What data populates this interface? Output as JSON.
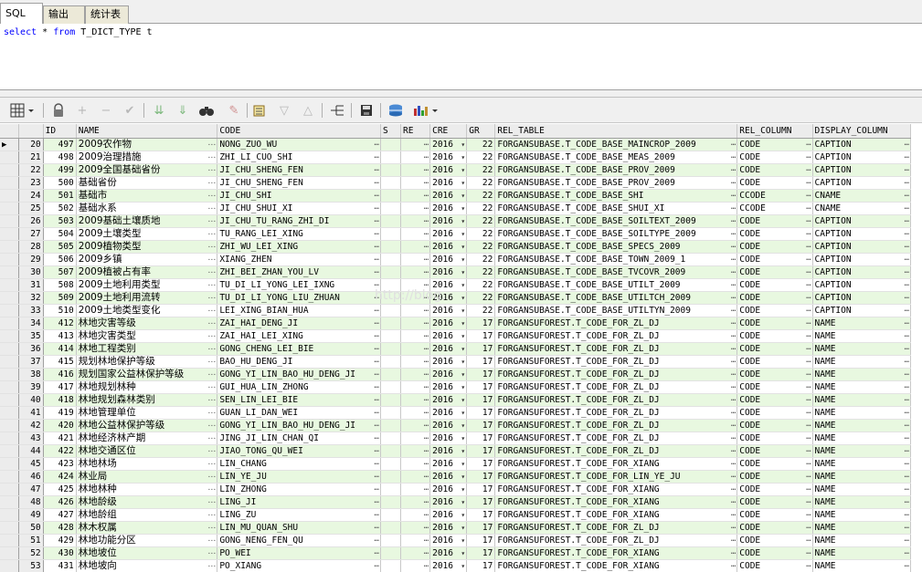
{
  "tabs": [
    "SQL",
    "输出",
    "统计表"
  ],
  "editor": {
    "kw1": "select",
    "star": " * ",
    "kw2": "from",
    "rest": " T_DICT_TYPE t"
  },
  "columns": [
    "",
    "ID",
    "NAME",
    "CODE",
    "S",
    "RE",
    "CRE",
    "GR",
    "REL_TABLE",
    "REL_COLUMN",
    "DISPLAY_COLUMN"
  ],
  "watermark": "http://blog.",
  "rows": [
    [
      "20",
      "497",
      "2009农作物",
      "NONG_ZUO_WU",
      "2016",
      "22",
      "FORGANSUBASE.T_CODE_BASE_MAINCROP_2009",
      "CODE",
      "CAPTION"
    ],
    [
      "21",
      "498",
      "2009治理措施",
      "ZHI_LI_CUO_SHI",
      "2016",
      "22",
      "FORGANSUBASE.T_CODE_BASE_MEAS_2009",
      "CODE",
      "CAPTION"
    ],
    [
      "22",
      "499",
      "2009全国基础省份",
      "JI_CHU_SHENG_FEN",
      "2016",
      "22",
      "FORGANSUBASE.T_CODE_BASE_PROV_2009",
      "CODE",
      "CAPTION"
    ],
    [
      "23",
      "500",
      "基础省份",
      "JI_CHU_SHENG_FEN",
      "2016",
      "22",
      "FORGANSUBASE.T_CODE_BASE_PROV_2009",
      "CODE",
      "CAPTION"
    ],
    [
      "24",
      "501",
      "基础市",
      "JI_CHU_SHI",
      "2016",
      "22",
      "FORGANSUBASE.T_CODE_BASE_SHI",
      "CCODE",
      "CNAME"
    ],
    [
      "25",
      "502",
      "基础水系",
      "JI_CHU_SHUI_XI",
      "2016",
      "22",
      "FORGANSUBASE.T_CODE_BASE_SHUI_XI",
      "CCODE",
      "CNAME"
    ],
    [
      "26",
      "503",
      "2009基础土壤质地",
      "JI_CHU_TU_RANG_ZHI_DI",
      "2016",
      "22",
      "FORGANSUBASE.T_CODE_BASE_SOILTEXT_2009",
      "CODE",
      "CAPTION"
    ],
    [
      "27",
      "504",
      "2009土壤类型",
      "TU_RANG_LEI_XING",
      "2016",
      "22",
      "FORGANSUBASE.T_CODE_BASE_SOILTYPE_2009",
      "CODE",
      "CAPTION"
    ],
    [
      "28",
      "505",
      "2009植物类型",
      "ZHI_WU_LEI_XING",
      "2016",
      "22",
      "FORGANSUBASE.T_CODE_BASE_SPECS_2009",
      "CODE",
      "CAPTION"
    ],
    [
      "29",
      "506",
      "2009乡镇",
      "XIANG_ZHEN",
      "2016",
      "22",
      "FORGANSUBASE.T_CODE_BASE_TOWN_2009_1",
      "CODE",
      "CAPTION"
    ],
    [
      "30",
      "507",
      "2009植被占有率",
      "ZHI_BEI_ZHAN_YOU_LV",
      "2016",
      "22",
      "FORGANSUBASE.T_CODE_BASE_TVCOVR_2009",
      "CODE",
      "CAPTION"
    ],
    [
      "31",
      "508",
      "2009土地利用类型",
      "TU_DI_LI_YONG_LEI_IXNG",
      "2016",
      "22",
      "FORGANSUBASE.T_CODE_BASE_UTILT_2009",
      "CODE",
      "CAPTION"
    ],
    [
      "32",
      "509",
      "2009土地利用流转",
      "TU_DI_LI_YONG_LIU_ZHUAN",
      "2016",
      "22",
      "FORGANSUBASE.T_CODE_BASE_UTILTCH_2009",
      "CODE",
      "CAPTION"
    ],
    [
      "33",
      "510",
      "2009土地类型变化",
      "LEI_XING_BIAN_HUA",
      "2016",
      "22",
      "FORGANSUBASE.T_CODE_BASE_UTILTYN_2009",
      "CODE",
      "CAPTION"
    ],
    [
      "34",
      "412",
      "林地灾害等级",
      "ZAI_HAI_DENG_JI",
      "2016",
      "17",
      "FORGANSUFOREST.T_CODE_FOR_ZL_DJ",
      "CODE",
      "NAME"
    ],
    [
      "35",
      "413",
      "林地灾害类型",
      "ZAI_HAI_LEI_XING",
      "2016",
      "17",
      "FORGANSUFOREST.T_CODE_FOR_ZL_DJ",
      "CODE",
      "NAME"
    ],
    [
      "36",
      "414",
      "林地工程类别",
      "GONG_CHENG_LEI_BIE",
      "2016",
      "17",
      "FORGANSUFOREST.T_CODE_FOR_ZL_DJ",
      "CODE",
      "NAME"
    ],
    [
      "37",
      "415",
      "规划林地保护等级",
      "BAO_HU_DENG_JI",
      "2016",
      "17",
      "FORGANSUFOREST.T_CODE_FOR_ZL_DJ",
      "CODE",
      "NAME"
    ],
    [
      "38",
      "416",
      "规划国家公益林保护等级",
      "GONG_YI_LIN_BAO_HU_DENG_JI",
      "2016",
      "17",
      "FORGANSUFOREST.T_CODE_FOR_ZL_DJ",
      "CODE",
      "NAME"
    ],
    [
      "39",
      "417",
      "林地规划林种",
      "GUI_HUA_LIN_ZHONG",
      "2016",
      "17",
      "FORGANSUFOREST.T_CODE_FOR_ZL_DJ",
      "CODE",
      "NAME"
    ],
    [
      "40",
      "418",
      "林地规划森林类别",
      "SEN_LIN_LEI_BIE",
      "2016",
      "17",
      "FORGANSUFOREST.T_CODE_FOR_ZL_DJ",
      "CODE",
      "NAME"
    ],
    [
      "41",
      "419",
      "林地管理单位",
      "GUAN_LI_DAN_WEI",
      "2016",
      "17",
      "FORGANSUFOREST.T_CODE_FOR_ZL_DJ",
      "CODE",
      "NAME"
    ],
    [
      "42",
      "420",
      "林地公益林保护等级",
      "GONG_YI_LIN_BAO_HU_DENG_JI",
      "2016",
      "17",
      "FORGANSUFOREST.T_CODE_FOR_ZL_DJ",
      "CODE",
      "NAME"
    ],
    [
      "43",
      "421",
      "林地经济林产期",
      "JING_JI_LIN_CHAN_QI",
      "2016",
      "17",
      "FORGANSUFOREST.T_CODE_FOR_ZL_DJ",
      "CODE",
      "NAME"
    ],
    [
      "44",
      "422",
      "林地交通区位",
      "JIAO_TONG_QU_WEI",
      "2016",
      "17",
      "FORGANSUFOREST.T_CODE_FOR_ZL_DJ",
      "CODE",
      "NAME"
    ],
    [
      "45",
      "423",
      "林地林场",
      "LIN_CHANG",
      "2016",
      "17",
      "FORGANSUFOREST.T_CODE_FOR_XIANG",
      "CODE",
      "NAME"
    ],
    [
      "46",
      "424",
      "林业局",
      "LIN_YE_JU",
      "2016",
      "17",
      "FORGANSUFOREST.T_CODE_FOR_LIN_YE_JU",
      "CODE",
      "NAME"
    ],
    [
      "47",
      "425",
      "林地林种",
      "LIN_ZHONG",
      "2016",
      "17",
      "FORGANSUFOREST.T_CODE_FOR_XIANG",
      "CODE",
      "NAME"
    ],
    [
      "48",
      "426",
      "林地龄级",
      "LING_JI",
      "2016",
      "17",
      "FORGANSUFOREST.T_CODE_FOR_XIANG",
      "CODE",
      "NAME"
    ],
    [
      "49",
      "427",
      "林地龄组",
      "LING_ZU",
      "2016",
      "17",
      "FORGANSUFOREST.T_CODE_FOR_XIANG",
      "CODE",
      "NAME"
    ],
    [
      "50",
      "428",
      "林木权属",
      "LIN_MU_QUAN_SHU",
      "2016",
      "17",
      "FORGANSUFOREST.T_CODE_FOR_ZL_DJ",
      "CODE",
      "NAME"
    ],
    [
      "51",
      "429",
      "林地功能分区",
      "GONG_NENG_FEN_QU",
      "2016",
      "17",
      "FORGANSUFOREST.T_CODE_FOR_ZL_DJ",
      "CODE",
      "NAME"
    ],
    [
      "52",
      "430",
      "林地坡位",
      "PO_WEI",
      "2016",
      "17",
      "FORGANSUFOREST.T_CODE_FOR_XIANG",
      "CODE",
      "NAME"
    ],
    [
      "53",
      "431",
      "林地坡向",
      "PO_XIANG",
      "2016",
      "17",
      "FORGANSUFOREST.T_CODE_FOR_XIANG",
      "CODE",
      "NAME"
    ]
  ],
  "toolbar": [
    "grid-menu-icon",
    "lock-icon",
    "add-record-icon",
    "delete-record-icon",
    "post-record-icon",
    "next-page-icon",
    "last-page-icon",
    "find-icon",
    "clear-icon",
    "query-icon",
    "filter-icon",
    "sort-icon",
    "tree-icon",
    "save-icon",
    "export-icon",
    "chart-icon"
  ]
}
